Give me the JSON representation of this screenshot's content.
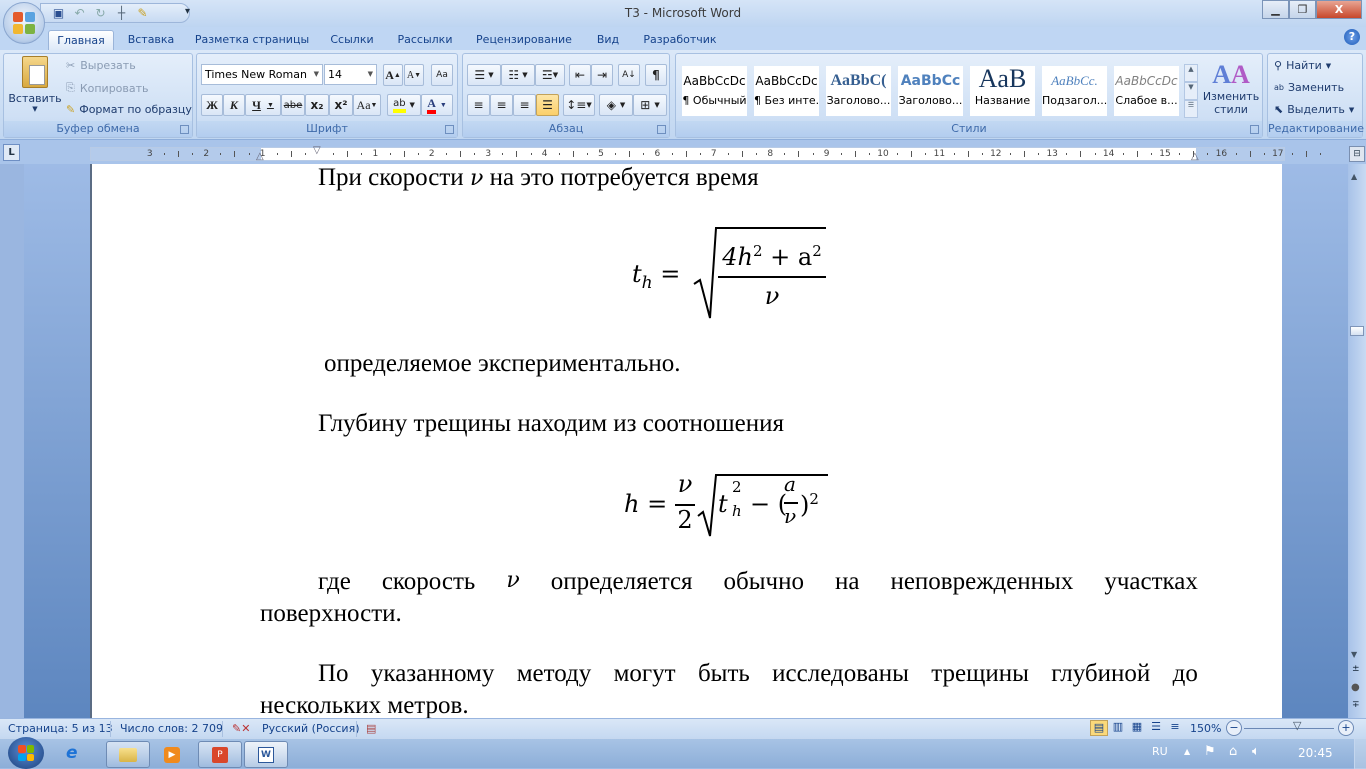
{
  "window": {
    "title": "Т3 - Microsoft Word",
    "minimize_icon": "minimize-icon",
    "restore_icon": "restore-icon",
    "close_icon": "close-icon"
  },
  "quick_access": [
    "save-icon",
    "undo-icon",
    "redo-icon",
    "insert-table-icon",
    "format-painter-icon",
    "customize-qat-icon"
  ],
  "tabs": [
    {
      "label": "Главная",
      "active": true
    },
    {
      "label": "Вставка"
    },
    {
      "label": "Разметка страницы"
    },
    {
      "label": "Ссылки"
    },
    {
      "label": "Рассылки"
    },
    {
      "label": "Рецензирование"
    },
    {
      "label": "Вид"
    },
    {
      "label": "Разработчик"
    }
  ],
  "ribbon": {
    "clipboard": {
      "label": "Буфер обмена",
      "paste": "Вставить",
      "cut": "Вырезать",
      "copy": "Копировать",
      "format_painter": "Формат по образцу"
    },
    "font": {
      "label": "Шрифт",
      "font_name": "Times New Roman",
      "font_size": "14",
      "bold": "Ж",
      "italic": "К",
      "underline": "Ч",
      "strike": "abe",
      "subscript": "x₂",
      "superscript": "x²",
      "change_case": "Aa",
      "grow": "A",
      "shrink": "A",
      "font_color": "A",
      "highlight_color": "#ffff00",
      "font_color_value": "#ff0000"
    },
    "paragraph": {
      "label": "Абзац",
      "active_alignment": "justify"
    },
    "styles": {
      "label": "Стили",
      "items": [
        {
          "sample": "AaBbCcDc",
          "name": "¶ Обычный"
        },
        {
          "sample": "AaBbCcDc",
          "name": "¶ Без инте..."
        },
        {
          "sample": "AaBbC(",
          "name": "Заголово..."
        },
        {
          "sample": "AaBbCc",
          "name": "Заголово..."
        },
        {
          "sample": "AaB",
          "name": "Название"
        },
        {
          "sample": "AaBbCc.",
          "name": "Подзагол..."
        },
        {
          "sample": "AaBbCcDc",
          "name": "Слабое в..."
        }
      ],
      "change_styles": "Изменить стили"
    },
    "editing": {
      "label": "Редактирование",
      "find": "Найти",
      "replace": "Заменить",
      "select": "Выделить"
    }
  },
  "ruler": {
    "left_ticks": [
      "3",
      "2",
      "1"
    ],
    "right_ticks": [
      "1",
      "2",
      "3",
      "4",
      "5",
      "6",
      "7",
      "8",
      "9",
      "10",
      "11",
      "12",
      "13",
      "14",
      "15",
      "16",
      "17"
    ]
  },
  "document": {
    "p1": "При скорости ",
    "p1_var": "ν",
    "p1_rest": " на это потребуется время",
    "eq1": {
      "lhs": "t",
      "lhs_sub": "h",
      "num": "4h² + a²",
      "den": "ν"
    },
    "p2": "определяемое экспериментально.",
    "p3": "Глубину трещины находим из соотношения",
    "eq2": {
      "lhs": "h",
      "frac_num": "ν",
      "frac_den": "2",
      "t": "t",
      "t_sub": "h",
      "t_sup": "2",
      "inner_num": "a",
      "inner_den": "ν"
    },
    "p4_a": "где скорость ",
    "p4_var": "ν",
    "p4_b": " определяется обычно на неповрежденных участках",
    "p4_c": "поверхности.",
    "p5_a": "По указанному методу могут быть исследованы трещины глубиной до",
    "p5_b": "нескольких метров."
  },
  "status": {
    "page": "Страница: 5 из 13",
    "words": "Число слов: 2 709",
    "language": "Русский (Россия)",
    "zoom": "150%",
    "zoom_fraction": 0.6
  },
  "taskbar": {
    "lang": "RU",
    "time": "20:45",
    "apps": [
      "internet-explorer-icon",
      "explorer-icon",
      "media-player-icon",
      "powerpoint-icon",
      "word-icon"
    ]
  }
}
